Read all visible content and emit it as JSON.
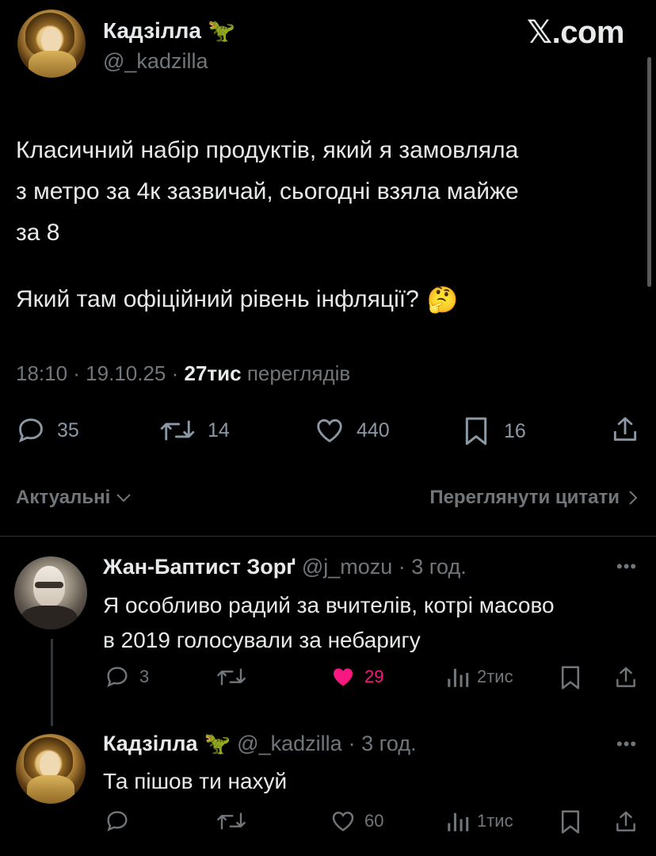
{
  "brand": "𝕏.com",
  "main_tweet": {
    "author_name": "Кадзілла",
    "author_emoji": "🦖",
    "author_handle": "@_kadzilla",
    "text_lines": [
      "Класичний набір продуктів, який я замовляла",
      "з метро за 4к зазвичай, сьогодні взяла майже",
      "за 8"
    ],
    "question": "Який там офіційний рівень інфляції?",
    "question_emoji": "🤔",
    "time": "18:10 · 19.10.25 · ",
    "views_count": "27тис",
    "views_label": " переглядів",
    "stats": {
      "replies": "35",
      "retweets": "14",
      "likes": "440",
      "bookmarks": "16"
    }
  },
  "sort": {
    "label": "Актуальні",
    "quotes_link": "Переглянути цитати"
  },
  "replies": [
    {
      "author_name": "Жан-Баптист Зорґ",
      "author_handle": "@j_mozu",
      "time": "· 3 год.",
      "text_lines": [
        "Я особливо радий за вчителів, котрі масово",
        "в 2019 голосували за небаригу"
      ],
      "replies": "3",
      "retweets": "",
      "likes": "29",
      "liked": true,
      "views": "2тис"
    },
    {
      "author_name": "Кадзілла",
      "author_emoji": "🦖",
      "author_handle": "@_kadzilla",
      "time": "· 3 год.",
      "text_lines": [
        "Та пішов ти нахуй"
      ],
      "replies": "",
      "retweets": "",
      "likes": "60",
      "liked": false,
      "views": "1тис"
    }
  ],
  "colors": {
    "background": "#000000",
    "text": "#e7e9ea",
    "muted": "#71767b",
    "like_active": "#f91880",
    "divider": "#2f3336"
  }
}
